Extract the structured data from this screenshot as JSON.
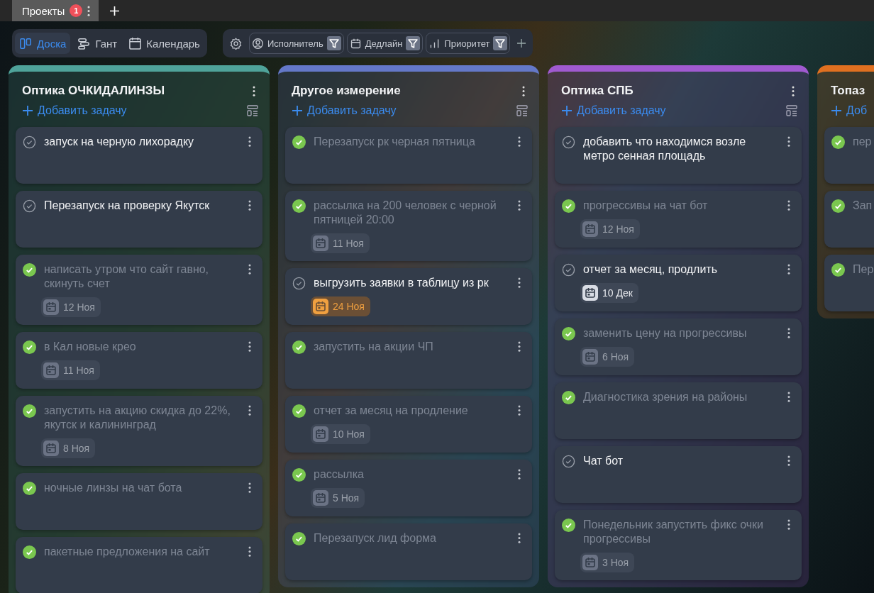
{
  "tabs": [
    {
      "label": "Проекты",
      "badge": "1",
      "selected": true
    }
  ],
  "views": [
    {
      "label": "Доска",
      "selected": true
    },
    {
      "label": "Гант",
      "selected": false
    },
    {
      "label": "Календарь",
      "selected": false
    }
  ],
  "filters": [
    {
      "label": "Исполнитель"
    },
    {
      "label": "Дедлайн"
    },
    {
      "label": "Приоритет"
    }
  ],
  "columns": [
    {
      "title": "Оптика ОЧКИДАЛИНЗЫ",
      "add_label": "Добавить задачу",
      "color": "#4fa39a",
      "tasks": [
        {
          "title": "запуск на черную лихорадку",
          "done": false
        },
        {
          "title": "Перезапуск на проверку Якутск",
          "done": false
        },
        {
          "title": "написать утром что сайт гавно, скинуть счет",
          "done": true,
          "date": "12 Ноя",
          "kind": "past"
        },
        {
          "title": "в Кал новые крео",
          "done": true,
          "date": "11 Ноя",
          "kind": "past"
        },
        {
          "title": "запустить на акцию скидка до 22%, якутск и калининград",
          "done": true,
          "date": "8 Ноя",
          "kind": "past"
        },
        {
          "title": "ночные линзы на чат бота",
          "done": true
        },
        {
          "title": "пакетные предложения на сайт",
          "done": true
        }
      ]
    },
    {
      "title": "Другое измерение",
      "add_label": "Добавить задачу",
      "color": "#6478c8",
      "tasks": [
        {
          "title": "Перезапуск рк черная пятница",
          "done": true
        },
        {
          "title": "рассылка на 200 человек с черной пятницей 20:00",
          "done": true,
          "date": "11 Ноя",
          "kind": "past"
        },
        {
          "title": "выгрузить заявки в таблицу из рк",
          "done": false,
          "date": "24 Ноя",
          "kind": "soon"
        },
        {
          "title": "запустить на акции ЧП",
          "done": true
        },
        {
          "title": "отчет за месяц на продление",
          "done": true,
          "date": "10 Ноя",
          "kind": "past"
        },
        {
          "title": "рассылка",
          "done": true,
          "date": "5 Ноя",
          "kind": "past"
        },
        {
          "title": "Перезапуск лид форма",
          "done": true
        }
      ]
    },
    {
      "title": "Оптика СПБ",
      "add_label": "Добавить задачу",
      "color": "#a05ad0",
      "tasks": [
        {
          "title": "добавить что находимся возле метро сенная площадь",
          "done": false
        },
        {
          "title": "прогрессивы на чат бот",
          "done": true,
          "date": "12 Ноя",
          "kind": "past"
        },
        {
          "title": "отчет за месяц, продлить",
          "done": false,
          "date": "10 Дек",
          "kind": "future"
        },
        {
          "title": "заменить цену на прогрессивы",
          "done": true,
          "date": "6 Ноя",
          "kind": "past"
        },
        {
          "title": "Диагностика зрения на районы",
          "done": true
        },
        {
          "title": "Чат бот",
          "done": false
        },
        {
          "title": "Понедельник запустить фикс очки прогрессивы",
          "done": true,
          "date": "3 Ноя",
          "kind": "past"
        }
      ]
    },
    {
      "title": "Топаз",
      "add_label": "Доб",
      "color": "#e07020",
      "tasks": [
        {
          "title": "пер",
          "done": true
        },
        {
          "title": "Зап",
          "done": true
        },
        {
          "title": "Пер",
          "done": true
        }
      ]
    }
  ]
}
